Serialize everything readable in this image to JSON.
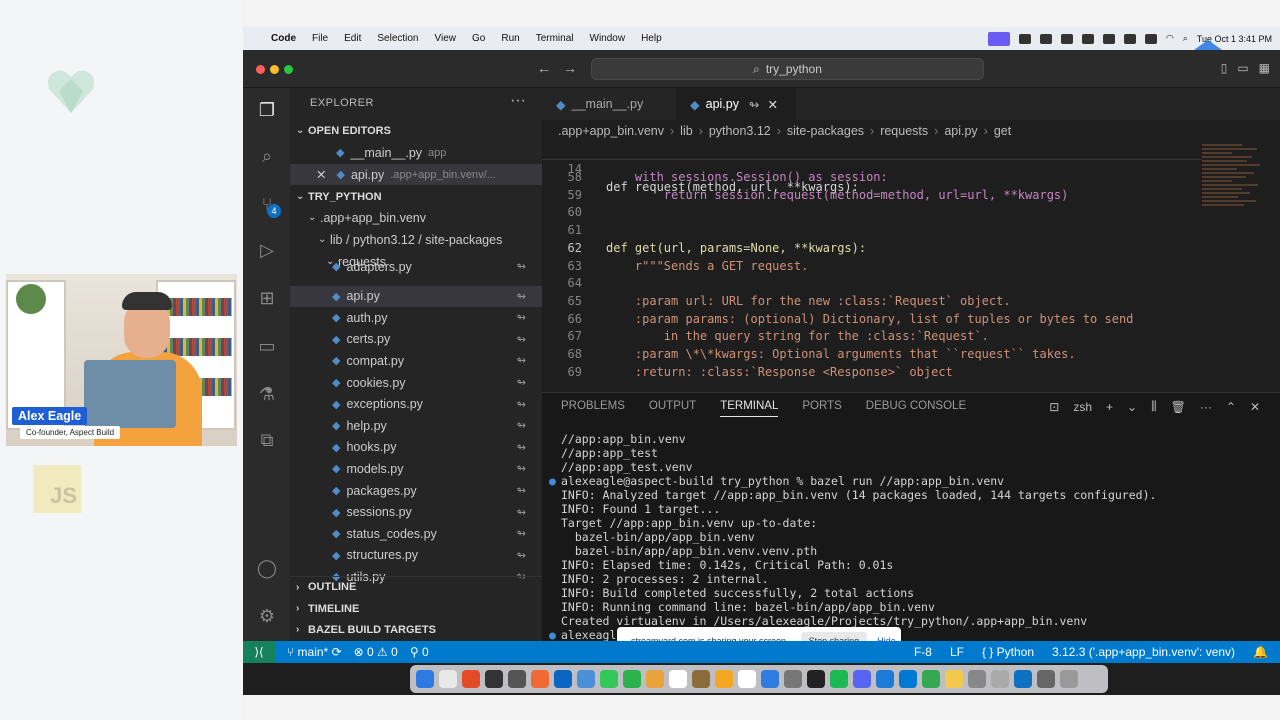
{
  "menubar": {
    "app": "Code",
    "items": [
      "File",
      "Edit",
      "Selection",
      "View",
      "Go",
      "Run",
      "Terminal",
      "Window",
      "Help"
    ],
    "datetime": "Tue Oct 1  3:41 PM"
  },
  "titlebar": {
    "search": "try_python"
  },
  "presenter": {
    "name": "Alex Eagle",
    "title": "Co-founder, Aspect Build"
  },
  "badge_js": "JS",
  "explorer": {
    "header": "EXPLORER",
    "open_editors_label": "OPEN EDITORS",
    "open_editors": [
      {
        "name": "__main__.py",
        "path": "app"
      },
      {
        "name": "api.py",
        "path": ".app+app_bin.venv/..."
      }
    ],
    "project": "TRY_PYTHON",
    "tree": [
      ".app+app_bin.venv",
      "lib / python3.12 / site-packages",
      "requests"
    ],
    "files": [
      "adapters.py",
      "api.py",
      "auth.py",
      "certs.py",
      "compat.py",
      "cookies.py",
      "exceptions.py",
      "help.py",
      "hooks.py",
      "models.py",
      "packages.py",
      "sessions.py",
      "status_codes.py",
      "structures.py",
      "utils.py"
    ],
    "outline": "OUTLINE",
    "timeline": "TIMELINE",
    "bazel": "BAZEL BUILD TARGETS",
    "git_badge": "4"
  },
  "tabs": [
    {
      "label": "__main__.py"
    },
    {
      "label": "api.py"
    }
  ],
  "breadcrumbs": [
    ".app+app_bin.venv",
    "lib",
    "python3.12",
    "site-packages",
    "requests",
    "api.py",
    "get"
  ],
  "code": {
    "sticky": "def request(method, url, **kwargs):",
    "lines": [
      {
        "n": "58",
        "t": "    with sessions.Session() as session:"
      },
      {
        "n": "59",
        "t": "        return session.request(method=method, url=url, **kwargs)"
      },
      {
        "n": "60",
        "t": ""
      },
      {
        "n": "61",
        "t": ""
      },
      {
        "n": "62",
        "t": "def get(url, params=None, **kwargs):"
      },
      {
        "n": "63",
        "t": "    r\"\"\"Sends a GET request."
      },
      {
        "n": "64",
        "t": ""
      },
      {
        "n": "65",
        "t": "    :param url: URL for the new :class:`Request` object."
      },
      {
        "n": "66",
        "t": "    :param params: (optional) Dictionary, list of tuples or bytes to send"
      },
      {
        "n": "67",
        "t": "        in the query string for the :class:`Request`."
      },
      {
        "n": "68",
        "t": "    :param \\*\\*kwargs: Optional arguments that ``request`` takes."
      },
      {
        "n": "69",
        "t": "    :return: :class:`Response <Response>` object"
      }
    ]
  },
  "panel": {
    "tabs": [
      "PROBLEMS",
      "OUTPUT",
      "TERMINAL",
      "PORTS",
      "DEBUG CONSOLE"
    ],
    "shell": "zsh",
    "terminal": [
      "//app:app_bin.venv",
      "//app:app_test",
      "//app:app_test.venv",
      "alexeagle@aspect-build try_python % bazel run //app:app_bin.venv",
      "INFO: Analyzed target //app:app_bin.venv (14 packages loaded, 144 targets configured).",
      "INFO: Found 1 target...",
      "Target //app:app_bin.venv up-to-date:",
      "  bazel-bin/app/app_bin.venv",
      "  bazel-bin/app/app_bin.venv.venv.pth",
      "INFO: Elapsed time: 0.142s, Critical Path: 0.01s",
      "INFO: 2 processes: 2 internal.",
      "INFO: Build completed successfully, 2 total actions",
      "INFO: Running command line: bazel-bin/app/app_bin.venv",
      "Created virtualenv in /Users/alexeagle/Projects/try_python/.app+app_bin.venv",
      "alexeagle@"
    ]
  },
  "share": {
    "text": "streamyard.com is sharing your screen.",
    "stop": "Stop sharing",
    "hide": "Hide"
  },
  "status": {
    "branch": "main*",
    "errors": "0",
    "warnings": "0",
    "ports": "0",
    "encoding": "F-8",
    "eol": "LF",
    "lang": "Python",
    "interpreter": "3.12.3 ('.app+app_bin.venv': venv)"
  },
  "colors": {
    "accent": "#007acc",
    "remote": "#16825d",
    "brand": "#1e5fd6"
  }
}
